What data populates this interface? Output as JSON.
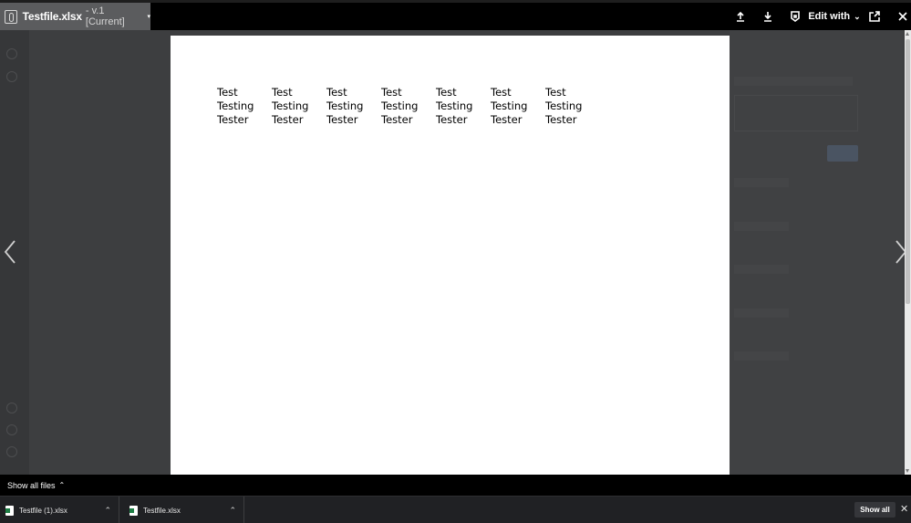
{
  "viewer": {
    "file_name": "Testfile.xlsx",
    "version_label": "- v.1 [Current]",
    "version_caret": "▾",
    "edit_with_label": "Edit with",
    "edit_with_chevron": "⌄"
  },
  "sheet": {
    "columns": [
      [
        "Test",
        "Testing",
        "Tester"
      ],
      [
        "Test",
        "Testing",
        "Tester"
      ],
      [
        "Test",
        "Testing",
        "Tester"
      ],
      [
        "Test",
        "Testing",
        "Tester"
      ],
      [
        "Test",
        "Testing",
        "Tester"
      ],
      [
        "Test",
        "Testing",
        "Tester"
      ],
      [
        "Test",
        "Testing",
        "Tester"
      ]
    ]
  },
  "footer": {
    "show_all_files_label": "Show all files",
    "show_all_files_caret": "⌃"
  },
  "downloads": {
    "items": [
      {
        "name": "Testfile (1).xlsx",
        "caret": "⌃"
      },
      {
        "name": "Testfile.xlsx",
        "caret": "⌃"
      }
    ],
    "show_all_label": "Show all",
    "close_glyph": "✕"
  },
  "icons": {
    "accent": "#000000",
    "file_tab_bg": "#5b5c5e",
    "excel_green": "#1e7e45"
  }
}
